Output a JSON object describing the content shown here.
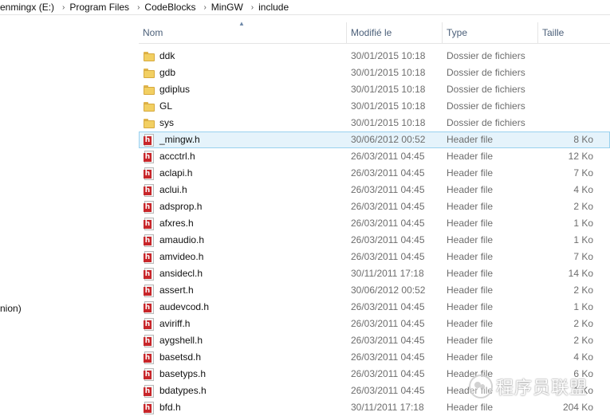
{
  "breadcrumb": [
    "enmingx (E:)",
    "Program Files",
    "CodeBlocks",
    "MinGW",
    "include"
  ],
  "breadcrumb_separator": "›",
  "nav": {
    "partial_item": "nion)"
  },
  "columns": {
    "name": "Nom",
    "modified": "Modifié le",
    "type": "Type",
    "size": "Taille"
  },
  "files": [
    {
      "name": "ddk",
      "modified": "30/01/2015 10:18",
      "type": "Dossier de fichiers",
      "size": "",
      "icon": "folder-icon"
    },
    {
      "name": "gdb",
      "modified": "30/01/2015 10:18",
      "type": "Dossier de fichiers",
      "size": "",
      "icon": "folder-icon"
    },
    {
      "name": "gdiplus",
      "modified": "30/01/2015 10:18",
      "type": "Dossier de fichiers",
      "size": "",
      "icon": "folder-icon"
    },
    {
      "name": "GL",
      "modified": "30/01/2015 10:18",
      "type": "Dossier de fichiers",
      "size": "",
      "icon": "folder-icon"
    },
    {
      "name": "sys",
      "modified": "30/01/2015 10:18",
      "type": "Dossier de fichiers",
      "size": "",
      "icon": "folder-icon"
    },
    {
      "name": "_mingw.h",
      "modified": "30/06/2012 00:52",
      "type": "Header file",
      "size": "8 Ko",
      "icon": "header-file-icon",
      "selected": true
    },
    {
      "name": "accctrl.h",
      "modified": "26/03/2011 04:45",
      "type": "Header file",
      "size": "12 Ko",
      "icon": "header-file-icon"
    },
    {
      "name": "aclapi.h",
      "modified": "26/03/2011 04:45",
      "type": "Header file",
      "size": "7 Ko",
      "icon": "header-file-icon"
    },
    {
      "name": "aclui.h",
      "modified": "26/03/2011 04:45",
      "type": "Header file",
      "size": "4 Ko",
      "icon": "header-file-icon"
    },
    {
      "name": "adsprop.h",
      "modified": "26/03/2011 04:45",
      "type": "Header file",
      "size": "2 Ko",
      "icon": "header-file-icon"
    },
    {
      "name": "afxres.h",
      "modified": "26/03/2011 04:45",
      "type": "Header file",
      "size": "1 Ko",
      "icon": "header-file-icon"
    },
    {
      "name": "amaudio.h",
      "modified": "26/03/2011 04:45",
      "type": "Header file",
      "size": "1 Ko",
      "icon": "header-file-icon"
    },
    {
      "name": "amvideo.h",
      "modified": "26/03/2011 04:45",
      "type": "Header file",
      "size": "7 Ko",
      "icon": "header-file-icon"
    },
    {
      "name": "ansidecl.h",
      "modified": "30/11/2011 17:18",
      "type": "Header file",
      "size": "14 Ko",
      "icon": "header-file-icon"
    },
    {
      "name": "assert.h",
      "modified": "30/06/2012 00:52",
      "type": "Header file",
      "size": "2 Ko",
      "icon": "header-file-icon"
    },
    {
      "name": "audevcod.h",
      "modified": "26/03/2011 04:45",
      "type": "Header file",
      "size": "1 Ko",
      "icon": "header-file-icon"
    },
    {
      "name": "aviriff.h",
      "modified": "26/03/2011 04:45",
      "type": "Header file",
      "size": "2 Ko",
      "icon": "header-file-icon"
    },
    {
      "name": "aygshell.h",
      "modified": "26/03/2011 04:45",
      "type": "Header file",
      "size": "2 Ko",
      "icon": "header-file-icon"
    },
    {
      "name": "basetsd.h",
      "modified": "26/03/2011 04:45",
      "type": "Header file",
      "size": "4 Ko",
      "icon": "header-file-icon"
    },
    {
      "name": "basetyps.h",
      "modified": "26/03/2011 04:45",
      "type": "Header file",
      "size": "6 Ko",
      "icon": "header-file-icon"
    },
    {
      "name": "bdatypes.h",
      "modified": "26/03/2011 04:45",
      "type": "Header file",
      "size": "1 Ko",
      "icon": "header-file-icon"
    },
    {
      "name": "bfd.h",
      "modified": "30/11/2011 17:18",
      "type": "Header file",
      "size": "204 Ko",
      "icon": "header-file-icon"
    }
  ],
  "watermark": {
    "text": "程序员联盟"
  },
  "colors": {
    "selection_bg": "#e5f3fb",
    "selection_border": "#99d1ef",
    "header_text": "#4c607a",
    "header_icon_red": "#c8262a",
    "folder_yellow": "#f2cf62"
  }
}
